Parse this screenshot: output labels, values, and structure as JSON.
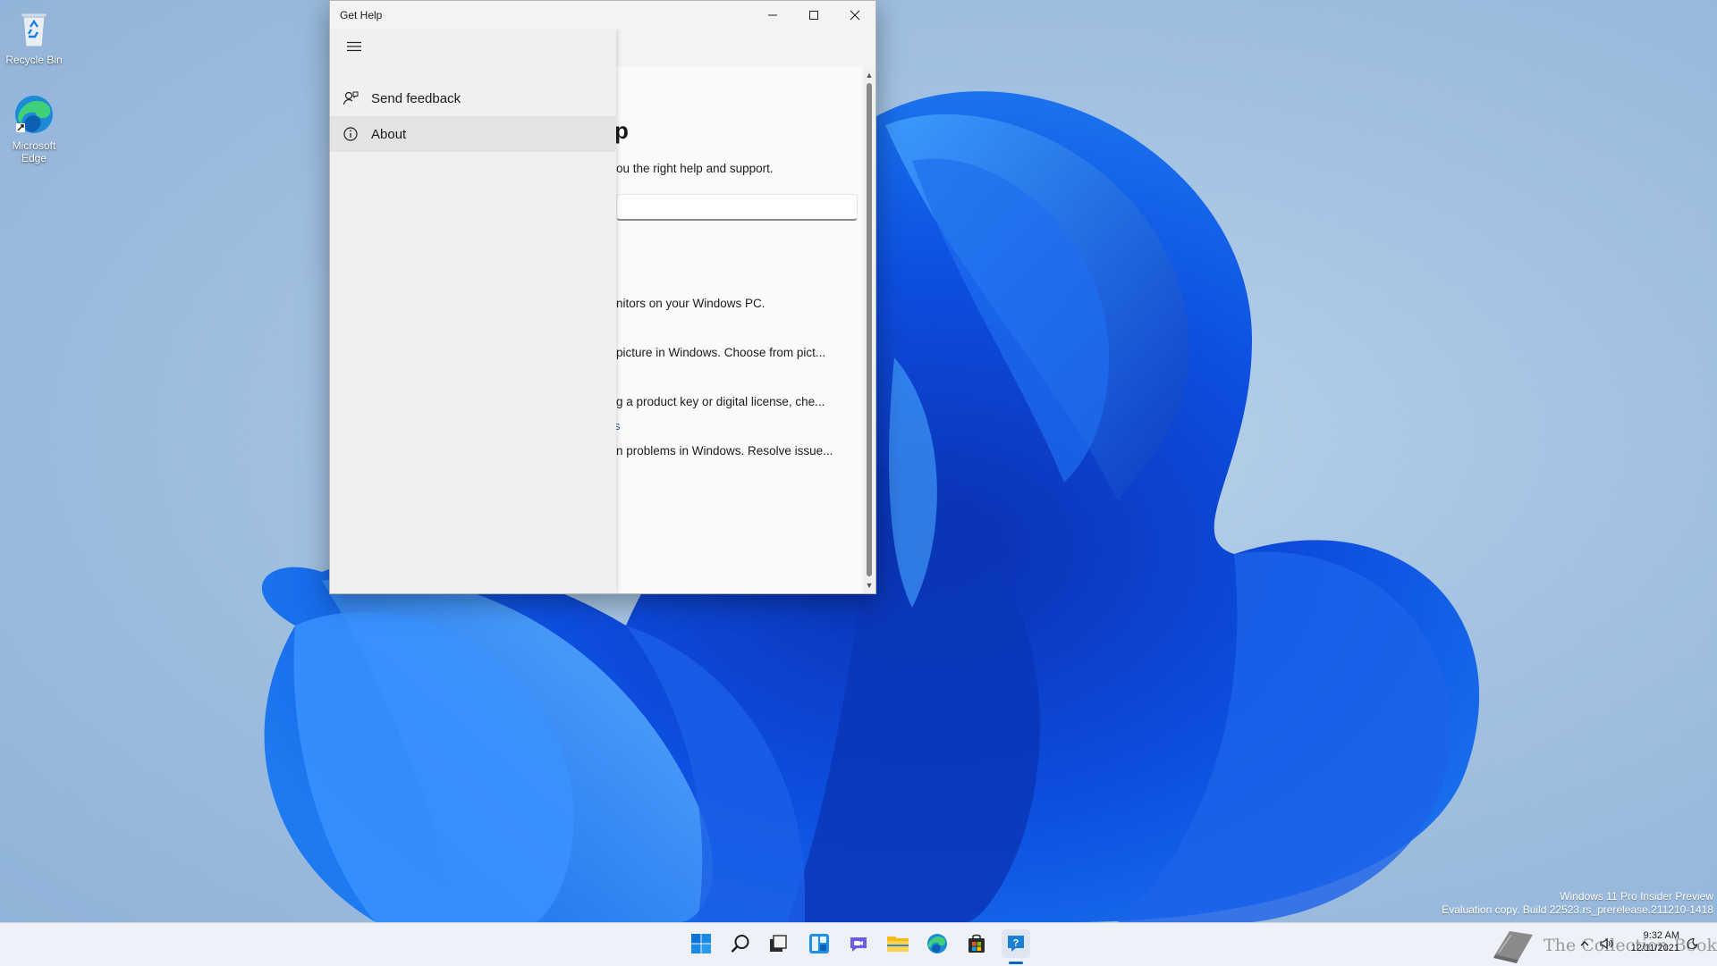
{
  "desktop": {
    "icons": [
      {
        "label": "Recycle Bin",
        "icon": "recycle-bin-icon"
      },
      {
        "label": "Microsoft Edge",
        "icon": "edge-icon"
      }
    ],
    "watermark": {
      "line1": "Windows 11 Pro Insider Preview",
      "line2": "Evaluation copy. Build 22523.rs_prerelease.211210-1418"
    }
  },
  "window": {
    "title": "Get Help",
    "caption": {
      "minimize": "minimize-icon",
      "maximize": "maximize-icon",
      "close": "close-icon"
    },
    "nav": {
      "menu_icon": "hamburger-icon",
      "items": [
        {
          "label": "Send feedback",
          "icon": "feedback-icon",
          "selected": false
        },
        {
          "label": "About",
          "icon": "info-icon",
          "selected": true
        }
      ]
    },
    "page": {
      "heading_fragment": "p",
      "subtitle_fragment": "ou the right help and support.",
      "results": [
        "nitors on your Windows PC.",
        "picture in Windows. Choose from pict...",
        "g a product key or digital license, che...",
        "n problems in Windows. Resolve issue..."
      ],
      "link_fragment": "s"
    }
  },
  "taskbar": {
    "icons": [
      "start-icon",
      "search-icon",
      "task-view-icon",
      "widgets-icon",
      "chat-icon",
      "file-explorer-icon",
      "edge-icon",
      "store-icon",
      "get-help-icon"
    ],
    "active": "get-help-icon",
    "tray": {
      "chevron": "chevron-up-icon",
      "speaker": "speaker-icon"
    },
    "clock": {
      "time": "9:32 AM",
      "date": "12/11/2021"
    },
    "brand_text": "The Collection Book"
  }
}
